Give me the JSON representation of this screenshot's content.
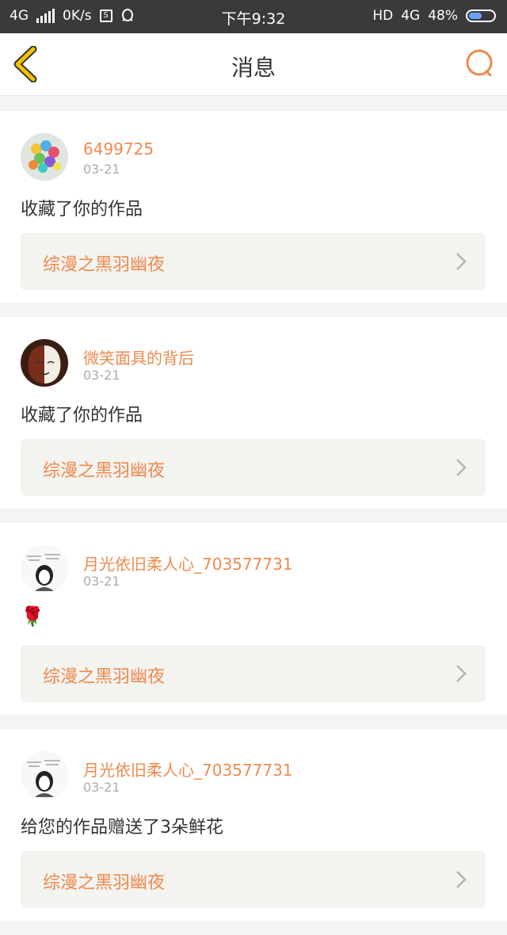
{
  "status_bar": {
    "network_left": "4G",
    "speed": "0K/s",
    "time": "下午9:32",
    "hd": "HD",
    "network_right": "4G",
    "battery": "48%",
    "battery_level": 0.48
  },
  "header": {
    "title": "消息"
  },
  "messages": [
    {
      "username": "6499725",
      "date": "03-21",
      "content": "收藏了你的作品",
      "work_title": "综漫之黑羽幽夜"
    },
    {
      "username": "微笑面具的背后",
      "date": "03-21",
      "content": "收藏了你的作品",
      "work_title": "综漫之黑羽幽夜"
    },
    {
      "username": "月光依旧柔人心_703577731",
      "date": "03-21",
      "content": "🌹",
      "work_title": "综漫之黑羽幽夜"
    },
    {
      "username": "月光依旧柔人心_703577731",
      "date": "03-21",
      "content": "给您的作品赠送了3朵鲜花",
      "work_title": "综漫之黑羽幽夜"
    }
  ],
  "colors": {
    "accent": "#ee8a4e",
    "back_arrow": "#f2c200"
  }
}
